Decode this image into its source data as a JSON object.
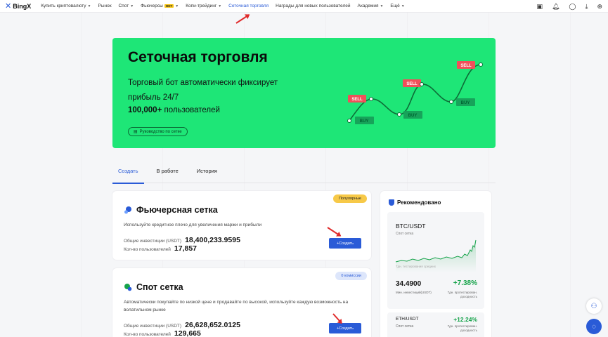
{
  "nav": {
    "brand": "BingX",
    "items": [
      {
        "label": "Купить криптовалюту",
        "caret": true
      },
      {
        "label": "Рынок",
        "caret": false
      },
      {
        "label": "Спот",
        "caret": true
      },
      {
        "label": "Фьючерсы",
        "caret": true,
        "badge": "HOT"
      },
      {
        "label": "Копи-трейдинг",
        "caret": true
      },
      {
        "label": "Сеточная торговля",
        "caret": false,
        "active": true
      },
      {
        "label": "Награды для новых пользователей",
        "caret": false
      },
      {
        "label": "Академия",
        "caret": true
      },
      {
        "label": "Ещё",
        "caret": true
      }
    ],
    "icons": [
      "wallet-icon",
      "bell-icon",
      "user-icon",
      "download-icon",
      "globe-icon"
    ]
  },
  "hero": {
    "title": "Сеточная торговля",
    "subtitle": "Торговый бот автоматически фиксирует прибыль 24/7",
    "users_count": "100,000+",
    "users_label": "пользователей",
    "guide": "Руководство по сетке",
    "sell_label": "SELL",
    "buy_label": "BUY"
  },
  "tabs": [
    "Создать",
    "В работе",
    "История"
  ],
  "futures": {
    "badge": "Популярные",
    "title": "Фьючерсная сетка",
    "desc": "Используйте кредитное плечо для увеличения маржи и прибыли",
    "invest_label": "Общие инвестиции (USDT)",
    "invest_value": "18,400,233.9595",
    "users_label": "Кол-во пользователей",
    "users_value": "17,857",
    "button": "+Создать"
  },
  "spot": {
    "badge": "0 комиссии",
    "title": "Спот сетка",
    "desc": "Автоматически покупайте по низкой цене и продавайте по высокой, используйте каждую возможность на волатильном рынке",
    "invest_label": "Общие инвестиции (USDT)",
    "invest_value": "26,628,652.0125",
    "users_label": "Кол-во пользователей",
    "users_value": "129,665",
    "button": "+Создать"
  },
  "recommended": {
    "title": "Рекомендовано",
    "item1": {
      "pair": "BTC/USDT",
      "type": "Спот сетка",
      "chart_label": "7дн. тестирования средних",
      "price": "34.4900",
      "price_label": "Мин. инвестиций(USDT)",
      "pct": "+7.38%",
      "pct_label": "7дн. протестирован. доходность"
    },
    "item2": {
      "pair": "ETH/USDT",
      "type": "Спот сетка",
      "pct": "+12.24%",
      "pct_label": "7дн. протестирован. доходность"
    }
  },
  "colors": {
    "accent": "#2a5bd7",
    "hero_bg": "#1ee677",
    "sell": "#f0505a",
    "buy": "#17a35a",
    "positive": "#16a34a"
  }
}
